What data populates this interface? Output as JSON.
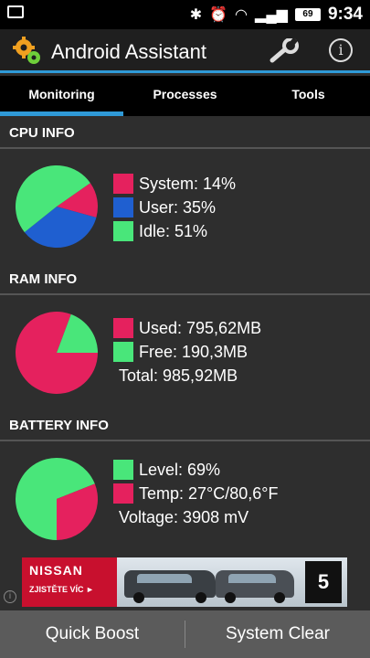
{
  "status_bar": {
    "battery_level": "69",
    "time": "9:34"
  },
  "app": {
    "title": "Android Assistant",
    "accent": "#2f9ad8"
  },
  "tabs": [
    {
      "label": "Monitoring",
      "active": true
    },
    {
      "label": "Processes",
      "active": false
    },
    {
      "label": "Tools",
      "active": false
    }
  ],
  "cpu": {
    "header": "CPU INFO",
    "system": "System: 14%",
    "user": "User: 35%",
    "idle": "Idle: 51%"
  },
  "ram": {
    "header": "RAM INFO",
    "used": "Used: 795,62MB",
    "free": "Free: 190,3MB",
    "total": "Total: 985,92MB"
  },
  "battery": {
    "header": "BATTERY INFO",
    "level": "Level: 69%",
    "temp": "Temp: 27°C/80,6°F",
    "voltage": "Voltage: 3908 mV"
  },
  "ad": {
    "brand": "NISSAN",
    "cta": "ZJISTĚTE VÍC ►",
    "badge": "5"
  },
  "bottom_bar": {
    "quick_boost": "Quick Boost",
    "system_clear": "System Clear"
  },
  "colors": {
    "pink": "#e5215e",
    "blue": "#1f5fd0",
    "green": "#49e67a"
  },
  "chart_data": [
    {
      "type": "pie",
      "labels": [
        "System",
        "User",
        "Idle"
      ],
      "values": [
        14,
        35,
        51
      ],
      "colors": [
        "#e5215e",
        "#1f5fd0",
        "#49e67a"
      ]
    },
    {
      "type": "pie",
      "labels": [
        "Used",
        "Free"
      ],
      "values": [
        795.62,
        190.3
      ],
      "colors": [
        "#e5215e",
        "#49e67a"
      ]
    },
    {
      "type": "pie",
      "labels": [
        "Level",
        "Temp"
      ],
      "values": [
        69,
        31
      ],
      "colors": [
        "#49e67a",
        "#e5215e"
      ]
    }
  ]
}
